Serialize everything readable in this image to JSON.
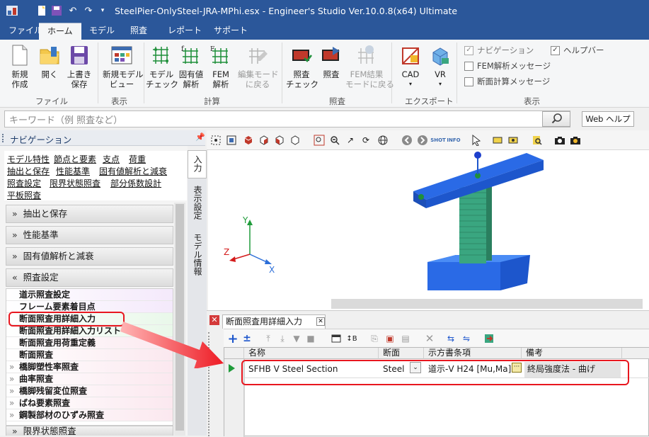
{
  "window": {
    "title": "SteelPier-OnlySteel-JRA-MPhi.esx - Engineer's Studio Ver.10.0.8(x64) Ultimate"
  },
  "ribbon_tabs": [
    "ファイル",
    "ホーム",
    "モデル",
    "照査",
    "レポート",
    "サポート"
  ],
  "ribbon": {
    "buttons": [
      {
        "label": "新規\n作成"
      },
      {
        "label": "開く"
      },
      {
        "label": "上書き\n保存"
      },
      {
        "label": "新規モデル\nビュー"
      },
      {
        "label": "モデル\nチェック"
      },
      {
        "label": "固有値\n解析"
      },
      {
        "label": "FEM\n解析"
      },
      {
        "label": "編集モード\nに戻る"
      },
      {
        "label": "照査\nチェック"
      },
      {
        "label": "照査"
      },
      {
        "label": "FEM結果\nモードに戻る"
      },
      {
        "label": "CAD"
      },
      {
        "label": "VR"
      }
    ],
    "groups": [
      "ファイル",
      "表示",
      "計算",
      "照査",
      "エクスポート",
      "表示"
    ],
    "checks": [
      {
        "label": "ナビゲーション",
        "checked": true,
        "disabled": true
      },
      {
        "label": "FEM解析メッセージ",
        "checked": false
      },
      {
        "label": "断面計算メッセージ",
        "checked": false
      },
      {
        "label": "ヘルプバー",
        "checked": true
      }
    ]
  },
  "search": {
    "placeholder": "キーワード（例 照査など）",
    "web_help": "Web ヘルプ"
  },
  "nav": {
    "title": "ナビゲーション",
    "pin": "ᵖ",
    "links": [
      "モデル特性",
      "節点と要素",
      "支点",
      "荷重",
      "抽出と保存",
      "性能基準",
      "固有値解析と減衰",
      "照査設定",
      "限界状態照査",
      "部分係数設計",
      "平板照査"
    ],
    "sections": [
      "抽出と保存",
      "性能基準",
      "固有値解析と減衰",
      "照査設定"
    ],
    "items": [
      "道示照査設定",
      "フレーム要素着目点",
      "断面照査用詳細入力",
      "断面照査用詳細入力リスト",
      "断面照査用荷重定義",
      "断面照査",
      "橋脚塑性率照査",
      "曲率照査",
      "橋脚残留変位照査",
      "ばね要素照査",
      "鋼製部材のひずみ照査"
    ],
    "bottom_section": "限界状態照査",
    "vtabs": [
      "入力",
      "表示設定",
      "モデル情報"
    ]
  },
  "view3d": {
    "axes": {
      "x": "X",
      "y": "Y",
      "z": "Z"
    }
  },
  "panel": {
    "tab": "断面照査用詳細入力",
    "columns": [
      "名称",
      "断面",
      "示方書条項",
      "備考"
    ],
    "rows": [
      {
        "name": "SFHB V Steel Section",
        "section": "Steel",
        "clause": "道示-V H24 [Mu,Ma]",
        "note": "終局強度法 - 曲げ"
      }
    ]
  },
  "colors": {
    "title": "#2b579a",
    "highlight": "#e8171f",
    "model_blue": "#1e5fd6",
    "pier_green": "#3aa680"
  }
}
